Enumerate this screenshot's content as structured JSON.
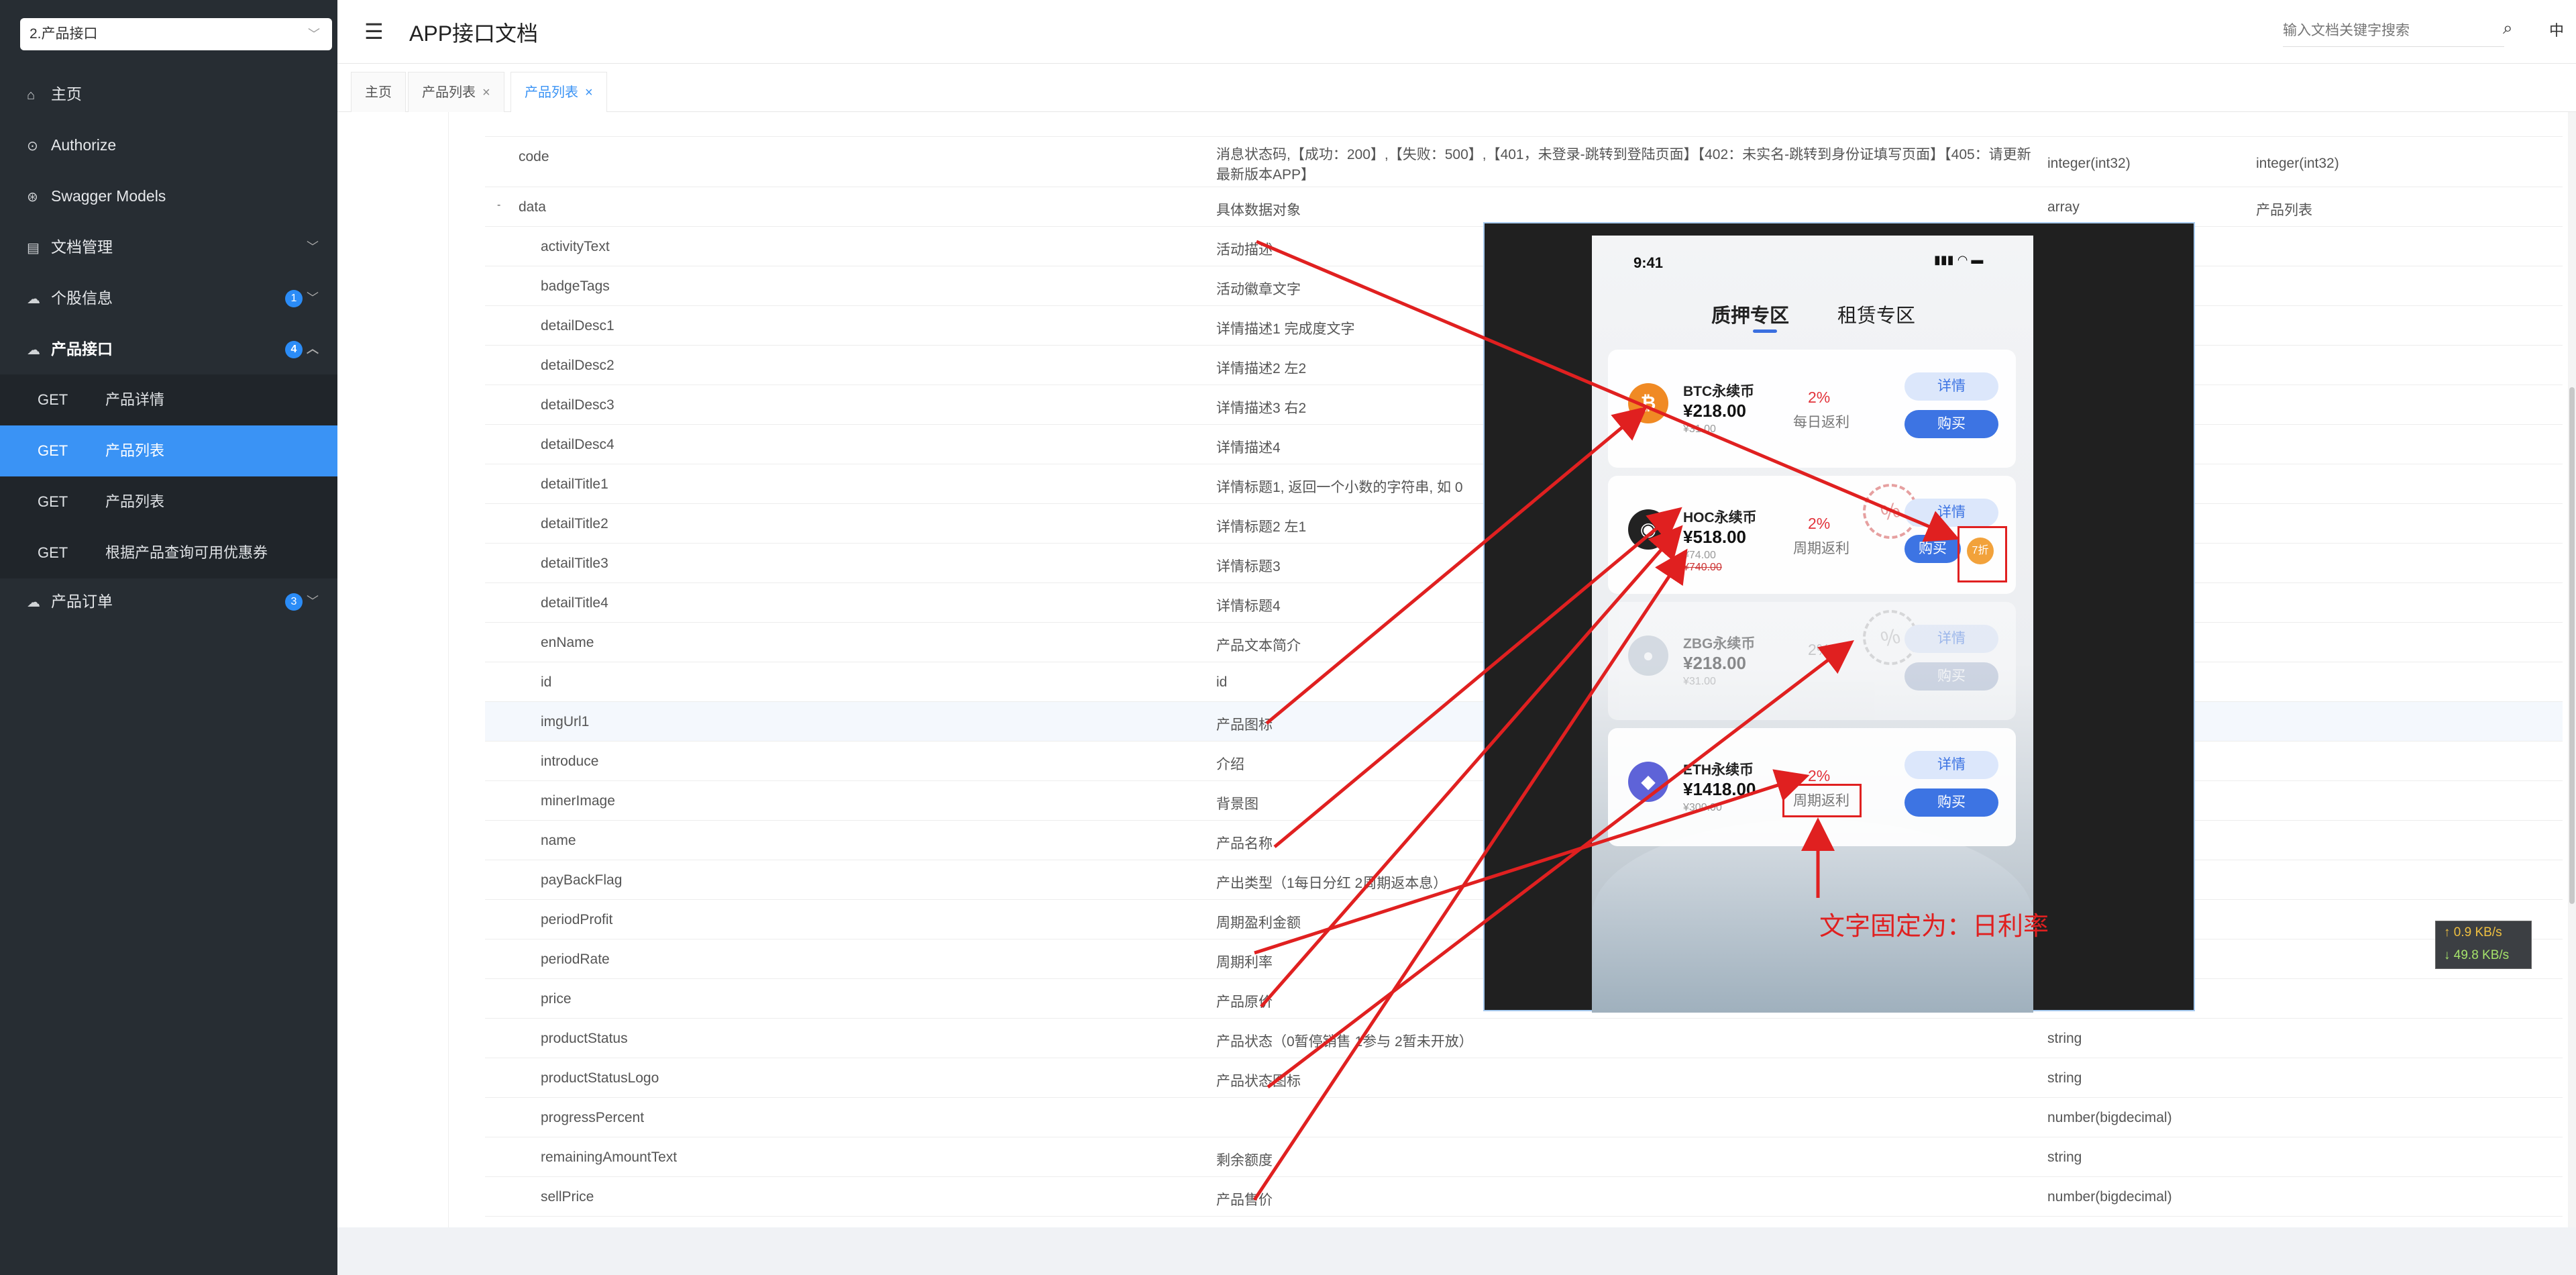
{
  "sidebar": {
    "selector": "2.产品接口",
    "items": [
      {
        "label": "主页",
        "icon": "home-icon"
      },
      {
        "label": "Authorize",
        "icon": "lock-icon"
      },
      {
        "label": "Swagger Models",
        "icon": "cube-icon"
      },
      {
        "label": "文档管理",
        "icon": "doc-icon"
      },
      {
        "label": "个股信息",
        "icon": "cloud-icon",
        "badge": "1"
      },
      {
        "label": "产品接口",
        "icon": "cloud-icon",
        "badge": "4"
      },
      {
        "label": "产品订单",
        "icon": "cloud-icon",
        "badge": "3"
      }
    ],
    "sub_items": [
      {
        "method": "GET",
        "label": "产品详情"
      },
      {
        "method": "GET",
        "label": "产品列表"
      },
      {
        "method": "GET",
        "label": "产品列表"
      },
      {
        "method": "GET",
        "label": "根据产品查询可用优惠券"
      }
    ]
  },
  "header": {
    "title": "APP接口文档",
    "search_placeholder": "输入文档关键字搜索",
    "lang": "中"
  },
  "tabs": [
    {
      "label": "主页"
    },
    {
      "label": "产品列表",
      "close": "×"
    },
    {
      "label": "产品列表",
      "close": "×"
    }
  ],
  "rows": [
    {
      "name": "code",
      "desc": "消息状态码,【成功：200】,【失败：500】,【401，未登录-跳转到登陆页面】【402：未实名-跳转到身份证填写页面】【405：请更新最新版本APP】",
      "type": "integer(int32)",
      "schema": "integer(int32)"
    },
    {
      "name": "data",
      "prefix": "-",
      "desc": "具体数据对象",
      "type": "array",
      "schema": "产品列表"
    },
    {
      "name": "activityText",
      "desc": "活动描述"
    },
    {
      "name": "badgeTags",
      "desc": "活动徽章文字"
    },
    {
      "name": "detailDesc1",
      "desc": "详情描述1 完成度文字"
    },
    {
      "name": "detailDesc2",
      "desc": "详情描述2 左2"
    },
    {
      "name": "detailDesc3",
      "desc": "详情描述3 右2"
    },
    {
      "name": "detailDesc4",
      "desc": "详情描述4"
    },
    {
      "name": "detailTitle1",
      "desc": "详情标题1, 返回一个小数的字符串, 如 0"
    },
    {
      "name": "detailTitle2",
      "desc": "详情标题2 左1"
    },
    {
      "name": "detailTitle3",
      "desc": "详情标题3"
    },
    {
      "name": "detailTitle4",
      "desc": "详情标题4"
    },
    {
      "name": "enName",
      "desc": "产品文本简介"
    },
    {
      "name": "id",
      "desc": "id"
    },
    {
      "name": "imgUrl1",
      "desc": "产品图标"
    },
    {
      "name": "introduce",
      "desc": "介绍"
    },
    {
      "name": "minerImage",
      "desc": "背景图"
    },
    {
      "name": "name",
      "desc": "产品名称"
    },
    {
      "name": "payBackFlag",
      "desc": "产出类型（1每日分红 2周期返本息）"
    },
    {
      "name": "periodProfit",
      "desc": "周期盈利金额"
    },
    {
      "name": "periodRate",
      "desc": "周期利率"
    },
    {
      "name": "price",
      "desc": "产品原价"
    },
    {
      "name": "productStatus",
      "desc": "产品状态（0暂停销售 1参与 2暂未开放）",
      "type": "string"
    },
    {
      "name": "productStatusLogo",
      "desc": "产品状态图标",
      "type": "string"
    },
    {
      "name": "progressPercent",
      "desc": "",
      "type": "number(bigdecimal)"
    },
    {
      "name": "remainingAmountText",
      "desc": "剩余额度",
      "type": "string"
    },
    {
      "name": "sellPrice",
      "desc": "产品售价",
      "type": "number(bigdecimal)"
    }
  ],
  "netspeed": {
    "up": "↑ 0.9 KB/s",
    "down": "↓ 49.8 KB/s"
  },
  "phone": {
    "time": "9:41",
    "tabs": [
      "质押专区",
      "租赁专区"
    ],
    "cards": [
      {
        "name": "BTC永续币",
        "price": "¥218.00",
        "sub": "¥31.00",
        "rate": "2%",
        "rate_label": "每日返利",
        "detail": "详情",
        "buy": "购买",
        "coin_color": "#f08a24",
        "coin_glyph": "₿"
      },
      {
        "name": "HOC永续币",
        "price": "¥518.00",
        "sub": "¥74.00",
        "old": "¥740.00",
        "rate": "2%",
        "rate_label": "周期返利",
        "detail": "详情",
        "buy": "购买",
        "discount": "7折",
        "coin_color": "#222222",
        "coin_glyph": "◉",
        "seal": "%"
      },
      {
        "name": "ZBG永续币",
        "price": "¥218.00",
        "sub": "¥31.00",
        "rate": "2%",
        "detail": "详情",
        "buy": "购买",
        "coin_color": "#b8c4d0",
        "coin_glyph": "●",
        "seal": "%"
      },
      {
        "name": "ETH永续币",
        "price": "¥1418.00",
        "sub": "¥300.00",
        "rate": "2%",
        "rate_label": "周期返利",
        "detail": "详情",
        "buy": "购买",
        "coin_color": "#5e63d8",
        "coin_glyph": "◆"
      }
    ]
  },
  "annotation": "文字固定为：日利率",
  "colors": {
    "sidebar_bg": "#272d33",
    "active": "#3a93f5",
    "annotation_red": "#e02020"
  }
}
